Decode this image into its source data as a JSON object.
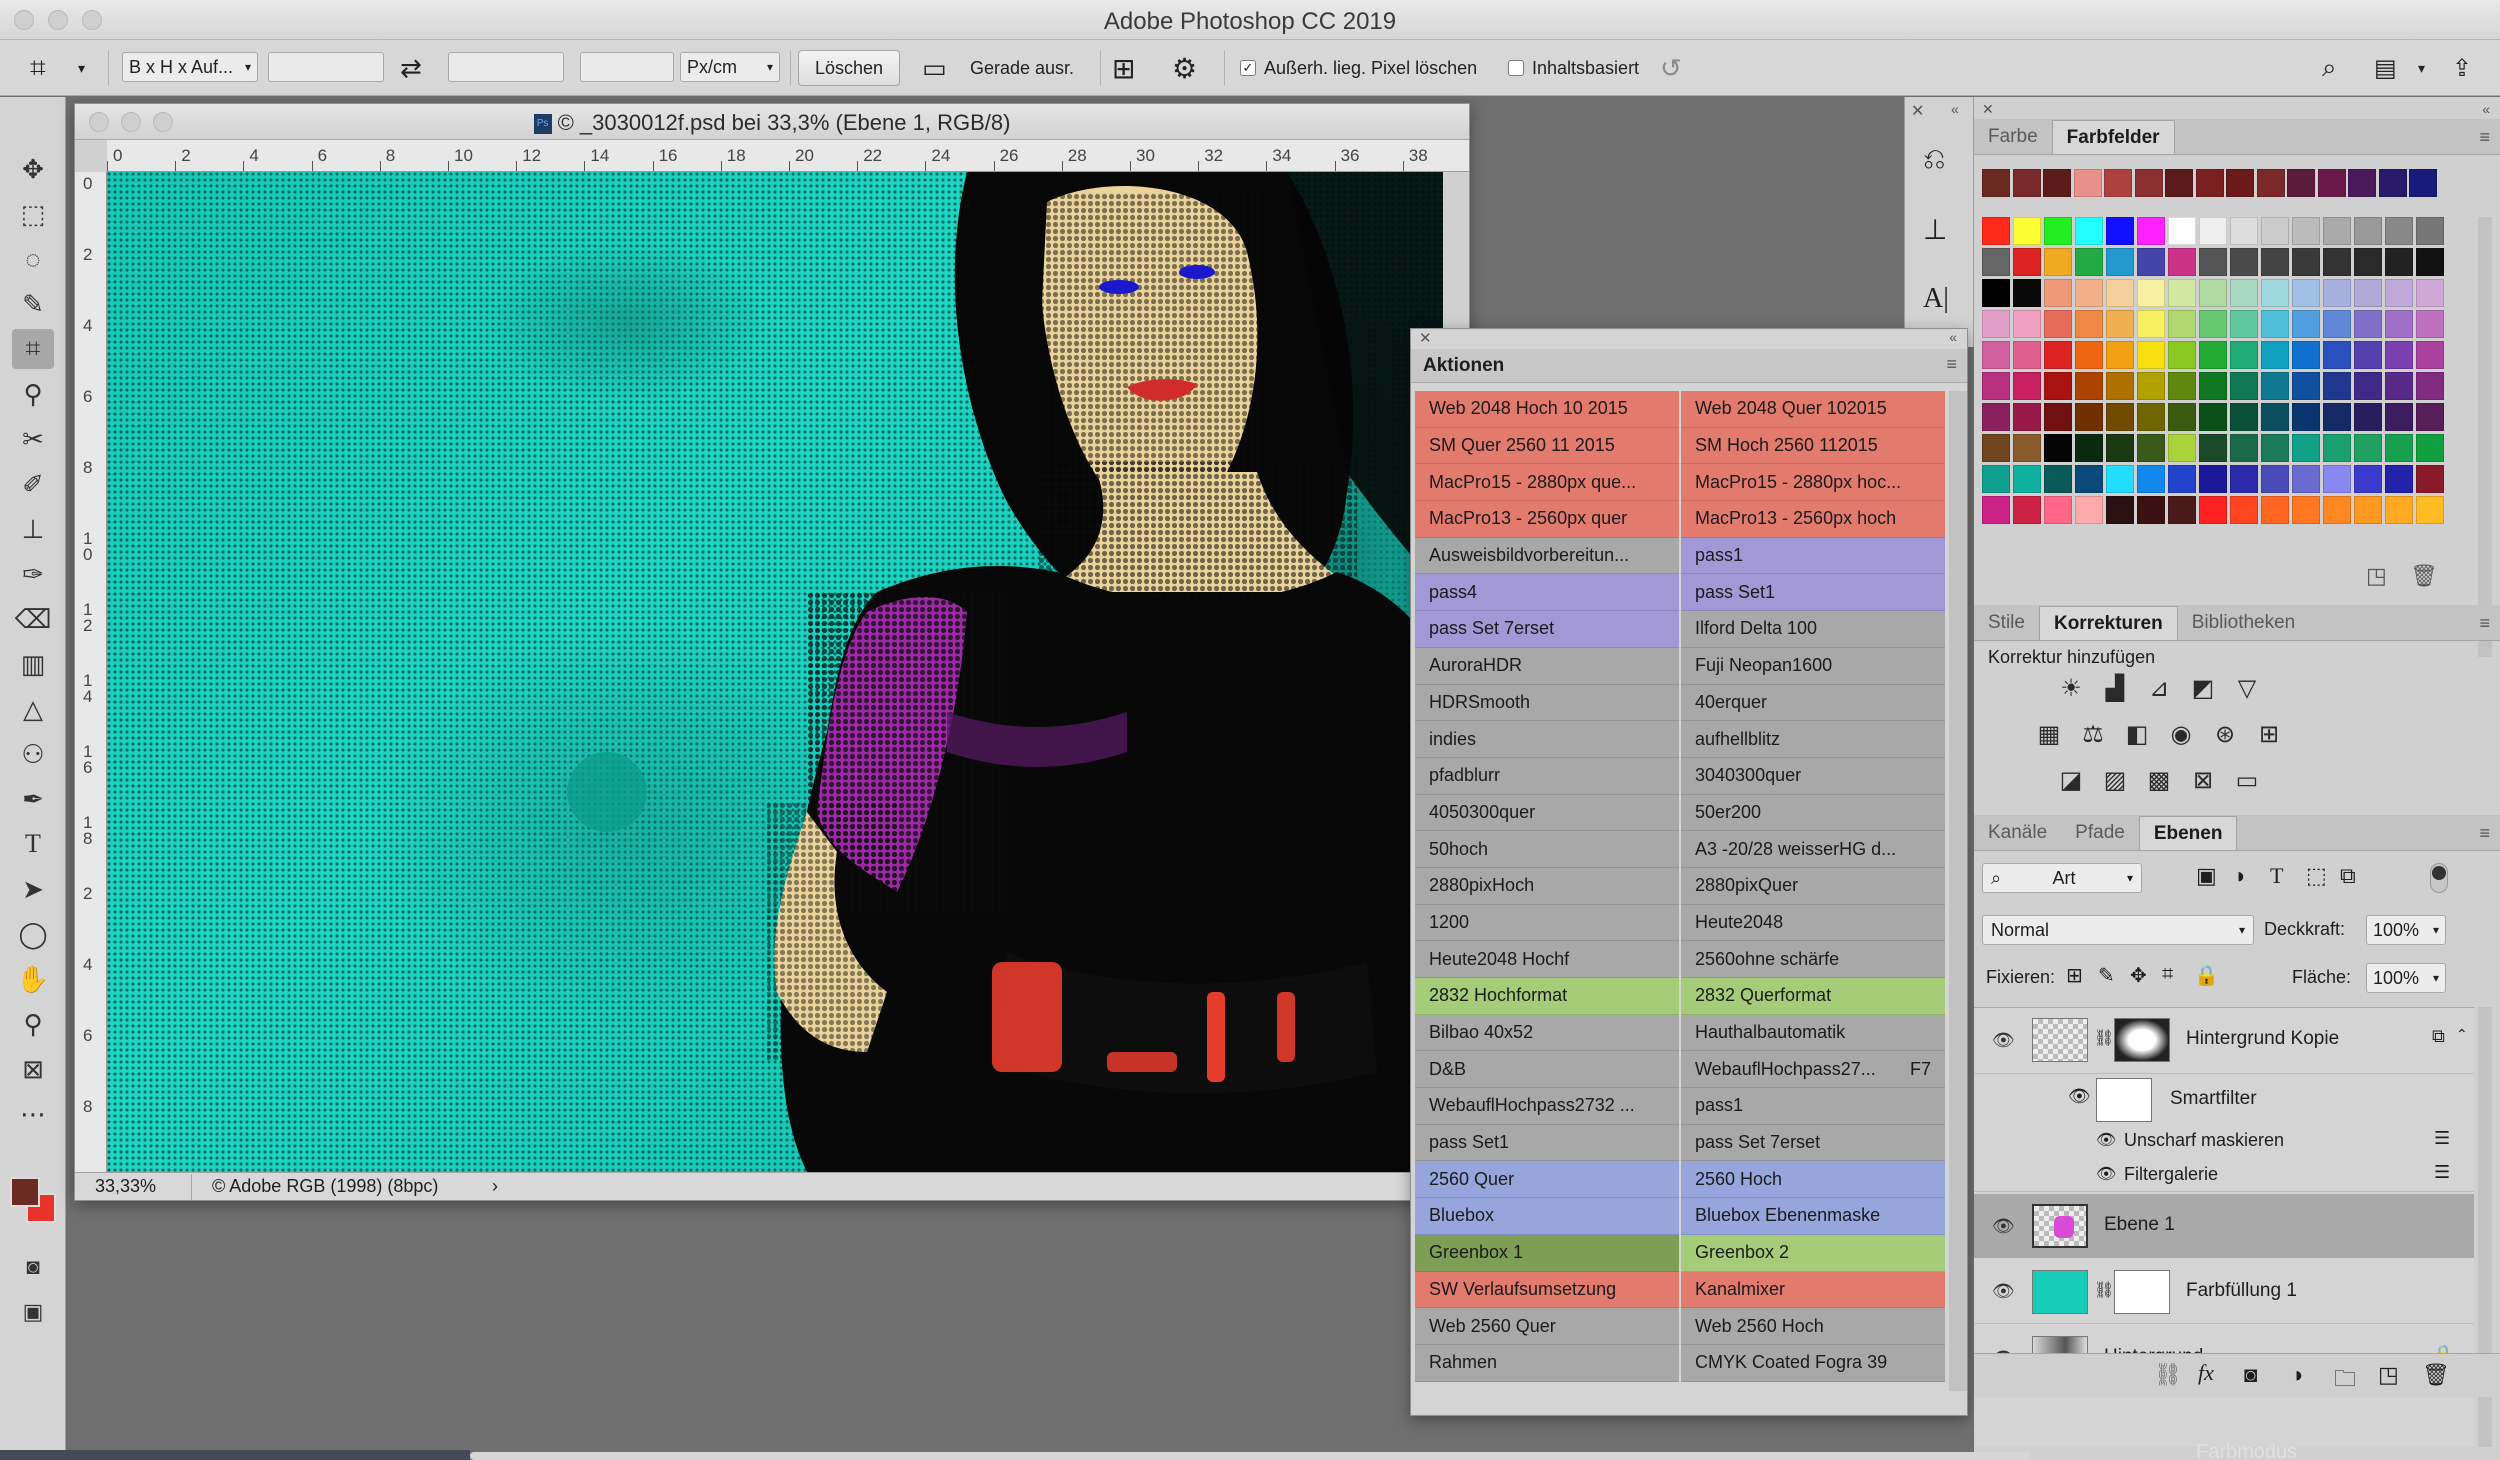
{
  "app": {
    "title": "Adobe Photoshop CC 2019"
  },
  "options": {
    "ratio_select": "B x H x Auf...",
    "unit_select": "Px/cm",
    "clear_button": "Löschen",
    "straighten_label": "Gerade ausr.",
    "delete_pixels_label": "Außerh. lieg. Pixel löschen",
    "content_aware_label": "Inhaltsbasiert"
  },
  "document": {
    "title": "_3030012f.psd bei 33,3% (Ebene 1, RGB/8)",
    "copyright_symbol": "©",
    "zoom": "33,33%",
    "profile": "© Adobe RGB (1998) (8bpc)",
    "ruler_h": [
      "0",
      "2",
      "4",
      "6",
      "8",
      "10",
      "12",
      "14",
      "16",
      "18",
      "20",
      "22",
      "24",
      "26",
      "28",
      "30",
      "32",
      "34",
      "36",
      "38"
    ],
    "ruler_v": [
      "0",
      "2",
      "4",
      "6",
      "8",
      "1\n0",
      "1\n2",
      "1\n4",
      "1\n6",
      "1\n8",
      "2",
      "4",
      "6",
      "8"
    ]
  },
  "actions": {
    "title": "Aktionen",
    "rows": [
      [
        "Web 2048 Hoch 10 2015",
        "Web 2048 Quer 102015"
      ],
      [
        "SM Quer 2560 11 2015",
        "SM Hoch 2560 112015"
      ],
      [
        "MacPro15 - 2880px que...",
        "MacPro15 - 2880px hoc..."
      ],
      [
        "MacPro13 - 2560px quer",
        "MacPro13 - 2560px hoch"
      ],
      [
        "Ausweisbildvorbereitun...",
        "pass1"
      ],
      [
        "pass4",
        "pass Set1"
      ],
      [
        "pass Set 7erset",
        "Ilford Delta 100"
      ],
      [
        "AuroraHDR",
        "Fuji Neopan1600"
      ],
      [
        "HDRSmooth",
        "40erquer"
      ],
      [
        "indies",
        "aufhellblitz"
      ],
      [
        "pfadblurr",
        "3040300quer"
      ],
      [
        "4050300quer",
        "50er200"
      ],
      [
        "50hoch",
        "A3 -20/28 weisserHG d..."
      ],
      [
        "2880pixHoch",
        "2880pixQuer"
      ],
      [
        "1200",
        "Heute2048"
      ],
      [
        "Heute2048 Hochf",
        "2560ohne schärfe"
      ],
      [
        "2832 Hochformat",
        "2832 Querformat"
      ],
      [
        "Bilbao 40x52",
        "Hauthalbautomatik"
      ],
      [
        "D&B",
        "WebauflHochpass27..."
      ],
      [
        "WebauflHochpass2732 ...",
        "pass1"
      ],
      [
        "pass Set1",
        "pass Set 7erset"
      ],
      [
        "2560 Quer",
        "2560 Hoch"
      ],
      [
        "Bluebox",
        "Bluebox Ebenenmaske"
      ],
      [
        "Greenbox 1",
        "Greenbox 2"
      ],
      [
        "SW Verlaufsumsetzung",
        "Kanalmixer"
      ],
      [
        "Web 2560 Quer",
        "Web 2560 Hoch"
      ],
      [
        "Rahmen",
        "CMYK Coated Fogra 39"
      ]
    ],
    "shortcut_label": "F7",
    "row_colors": [
      [
        "#e27b6e",
        "#e27b6e"
      ],
      [
        "#e27b6e",
        "#e27b6e"
      ],
      [
        "#e27b6e",
        "#e27b6e"
      ],
      [
        "#e27b6e",
        "#e27b6e"
      ],
      [
        "#a8a8a8",
        "#a398d6"
      ],
      [
        "#a398d6",
        "#a398d6"
      ],
      [
        "#a398d6",
        "#a8a8a8"
      ],
      [
        "#a8a8a8",
        "#a8a8a8"
      ],
      [
        "#a8a8a8",
        "#a8a8a8"
      ],
      [
        "#a8a8a8",
        "#a8a8a8"
      ],
      [
        "#a8a8a8",
        "#a8a8a8"
      ],
      [
        "#a8a8a8",
        "#a8a8a8"
      ],
      [
        "#a8a8a8",
        "#a8a8a8"
      ],
      [
        "#a8a8a8",
        "#a8a8a8"
      ],
      [
        "#a8a8a8",
        "#a8a8a8"
      ],
      [
        "#a8a8a8",
        "#a8a8a8"
      ],
      [
        "#a5cc78",
        "#a5cc78"
      ],
      [
        "#a8a8a8",
        "#a8a8a8"
      ],
      [
        "#a8a8a8",
        "#a8a8a8"
      ],
      [
        "#a8a8a8",
        "#a8a8a8"
      ],
      [
        "#a8a8a8",
        "#a8a8a8"
      ],
      [
        "#96a6dc",
        "#96a6dc"
      ],
      [
        "#96a6dc",
        "#96a6dc"
      ],
      [
        "#7f9e55",
        "#a5cc78"
      ],
      [
        "#e27b6e",
        "#e27b6e"
      ],
      [
        "#a8a8a8",
        "#a8a8a8"
      ],
      [
        "#a8a8a8",
        "#a8a8a8"
      ]
    ]
  },
  "swatches_panel": {
    "tabs": [
      "Farbe",
      "Farbfelder"
    ],
    "active_tab": "Farbfelder"
  },
  "adjustments_panel": {
    "tabs": [
      "Stile",
      "Korrekturen",
      "Bibliotheken"
    ],
    "active_tab": "Korrekturen",
    "label": "Korrektur hinzufügen"
  },
  "layers_panel": {
    "tabs": [
      "Kanäle",
      "Pfade",
      "Ebenen"
    ],
    "active_tab": "Ebenen",
    "filter_kind": "Art",
    "blend_mode": "Normal",
    "opacity_label": "Deckkraft:",
    "opacity_value": "100%",
    "lock_label": "Fixieren:",
    "fill_label": "Fläche:",
    "fill_value": "100%",
    "layers": [
      {
        "name": "Hintergrund Kopie"
      },
      {
        "name": "Smartfilter"
      },
      {
        "name": "Unscharf maskieren"
      },
      {
        "name": "Filtergalerie"
      },
      {
        "name": "Ebene 1"
      },
      {
        "name": "Farbfüllung 1"
      },
      {
        "name": "Hintergrund"
      }
    ],
    "footer_partial": "Farbmodus"
  },
  "colors": {
    "foreground": "#6b2a22",
    "background": "#e8332a",
    "canvas_cyan": "#1ccfbd"
  }
}
